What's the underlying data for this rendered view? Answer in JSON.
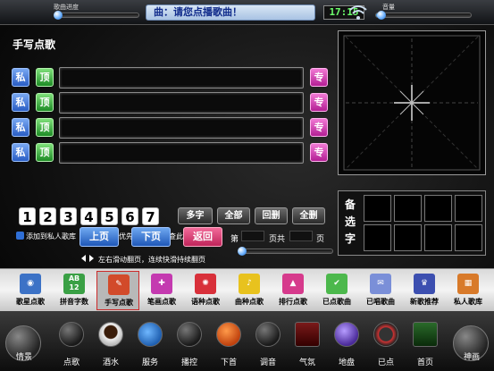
{
  "top_bar": {
    "progress_label": "歌曲进度",
    "progress_value": 0.03,
    "volume_label": "音量",
    "volume_value": 0.05,
    "now_playing": "曲：请您点播歌曲！",
    "clock": "17:15"
  },
  "panel": {
    "title": "手写点歌",
    "private_label": "私",
    "top_label": "顶",
    "album_label": "专",
    "number_keys": [
      "1",
      "2",
      "3",
      "4",
      "5",
      "6",
      "7"
    ],
    "action_buttons": [
      "多字",
      "全部",
      "回删",
      "全删"
    ],
    "legend": [
      {
        "text": "添加到私人歌库",
        "color": "#2f6fd6"
      },
      {
        "text": "将歌曲优先播放",
        "color": "#2aa52a"
      },
      {
        "text": "查此歌星专集",
        "color": "#c02fa8"
      }
    ],
    "prev_page": "上页",
    "next_page": "下页",
    "back": "返回",
    "page_label_1": "第",
    "page_label_2": "页共",
    "page_label_3": "页",
    "hint": "左右滑动翻页，连续快滑持续翻页",
    "candidate_label": "备选字"
  },
  "categories": [
    {
      "label": "歌星点歌",
      "icon": "singer-icon",
      "color": "#3c72c6"
    },
    {
      "label": "拼音字数",
      "icon": "ab12-icon",
      "color": "#3aa045"
    },
    {
      "label": "手写点歌",
      "icon": "pen-icon",
      "color": "#d24a2a",
      "active": true
    },
    {
      "label": "笔画点歌",
      "icon": "puzzle-icon",
      "color": "#c43ab0"
    },
    {
      "label": "语种点歌",
      "icon": "flame-icon",
      "color": "#d8303a"
    },
    {
      "label": "曲种点歌",
      "icon": "note-icon",
      "color": "#e8c21e"
    },
    {
      "label": "排行点歌",
      "icon": "arrow-up-icon",
      "color": "#d63a8c"
    },
    {
      "label": "已点歌曲",
      "icon": "check-icon",
      "color": "#4cb84c"
    },
    {
      "label": "已唱歌曲",
      "icon": "mail-icon",
      "color": "#7a8fd8"
    },
    {
      "label": "新歌推荐",
      "icon": "gift-icon",
      "color": "#3c4fb0"
    },
    {
      "label": "私人歌库",
      "icon": "grid-icon",
      "color": "#d87a2a"
    }
  ],
  "dock": {
    "left_label": "情景",
    "right_label": "神画",
    "items": [
      {
        "label": "点歌",
        "icon": "mic-icon"
      },
      {
        "label": "酒水",
        "icon": "coffee-icon"
      },
      {
        "label": "服务",
        "icon": "people-icon"
      },
      {
        "label": "播控",
        "icon": "clock-icon"
      },
      {
        "label": "下首",
        "icon": "play-icon"
      },
      {
        "label": "调音",
        "icon": "speaker-icon"
      },
      {
        "label": "气氛",
        "icon": "film-icon"
      },
      {
        "label": "地盘",
        "icon": "mic-stand-icon"
      },
      {
        "label": "已点",
        "icon": "speedometer-icon"
      },
      {
        "label": "首页",
        "icon": "monitor-icon"
      }
    ]
  }
}
